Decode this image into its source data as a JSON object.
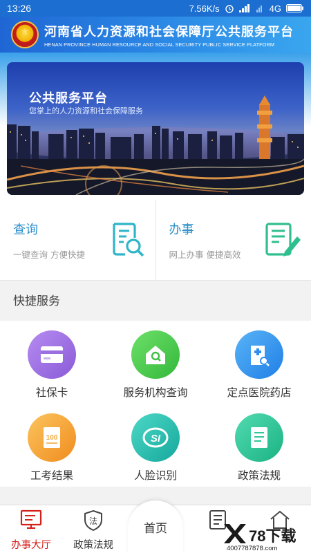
{
  "status_bar": {
    "time": "13:26",
    "speed": "7.56K/s",
    "network": "4G"
  },
  "header": {
    "title": "河南省人力资源和社会保障厅公共服务平台",
    "subtitle": "HENAN PROVINCE HUMAN RESOURCE AND SOCIAL SECURITY PUBLIC SERVICE PLATFORM"
  },
  "banner": {
    "title": "公共服务平台",
    "subtitle": "您掌上的人力资源和社会保障服务"
  },
  "cards": [
    {
      "title": "查询",
      "subtitle": "一键查询 方便快捷",
      "icon": "search-document-icon"
    },
    {
      "title": "办事",
      "subtitle": "网上办事 便捷高效",
      "icon": "edit-document-icon"
    }
  ],
  "quick_services": {
    "title": "快捷服务",
    "items": [
      {
        "label": "社保卡",
        "icon": "card-icon",
        "color": "#9b6fe0"
      },
      {
        "label": "服务机构查询",
        "icon": "house-search-icon",
        "color": "#4cc94a"
      },
      {
        "label": "定点医院药店",
        "icon": "hospital-icon",
        "color": "#2e8ff0"
      },
      {
        "label": "工考结果",
        "icon": "exam-result-icon",
        "color": "#f4a93a"
      },
      {
        "label": "人脸识别",
        "icon": "si-logo-icon",
        "color": "#22c1b4"
      },
      {
        "label": "政策法规",
        "icon": "book-icon",
        "color": "#2ec79a"
      }
    ]
  },
  "bottom_nav": {
    "items": [
      {
        "label": "办事大厅",
        "icon": "monitor-icon",
        "active": true
      },
      {
        "label": "政策法规",
        "icon": "law-shield-icon",
        "active": false
      },
      {
        "label": "首页",
        "icon": "home-icon",
        "active": false
      },
      {
        "label": "",
        "icon": "document-icon",
        "active": false
      },
      {
        "label": "",
        "icon": "house-icon",
        "active": false
      }
    ]
  },
  "watermark": {
    "text": "78下载",
    "url": "4007787878.com"
  }
}
